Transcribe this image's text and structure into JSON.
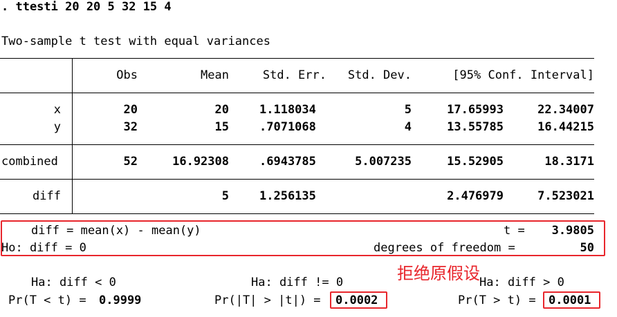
{
  "command": ". ttesti 20 20 5 32 15 4",
  "test_title": "Two-sample t test with equal variances",
  "table": {
    "headers": [
      "Obs",
      "Mean",
      "Std. Err.",
      "Std. Dev.",
      "[95% Conf. Interval]"
    ],
    "rows": [
      {
        "label": "x",
        "obs": "20",
        "mean": "20",
        "se": "1.118034",
        "sd": "5",
        "ci_lo": "17.65993",
        "ci_hi": "22.34007"
      },
      {
        "label": "y",
        "obs": "32",
        "mean": "15",
        "se": ".7071068",
        "sd": "4",
        "ci_lo": "13.55785",
        "ci_hi": "16.44215"
      },
      {
        "label": "combined",
        "obs": "52",
        "mean": "16.92308",
        "se": ".6943785",
        "sd": "5.007235",
        "ci_lo": "15.52905",
        "ci_hi": "18.3171"
      },
      {
        "label": "diff",
        "obs": "",
        "mean": "5",
        "se": "1.256135",
        "sd": "",
        "ci_lo": "2.476979",
        "ci_hi": "7.523021"
      }
    ]
  },
  "summary": {
    "diff_def": "diff = mean(x) - mean(y)",
    "t_label": "t =",
    "t_value": "3.9805",
    "ho": "Ho: diff = 0",
    "df_label": "degrees of freedom =",
    "df_value": "50"
  },
  "hypotheses": {
    "left": {
      "ha": "Ha: diff < 0",
      "pr_label": "Pr(T < t) =",
      "pr_value": "0.9999"
    },
    "two": {
      "ha": "Ha: diff != 0",
      "pr_label": "Pr(|T| > |t|) =",
      "pr_value": "0.0002"
    },
    "right": {
      "ha": "Ha: diff > 0",
      "pr_label": "Pr(T > t) =",
      "pr_value": "0.0001"
    }
  },
  "annotation": "拒绝原假设",
  "colors": {
    "annotation_red": "#e8262c"
  }
}
